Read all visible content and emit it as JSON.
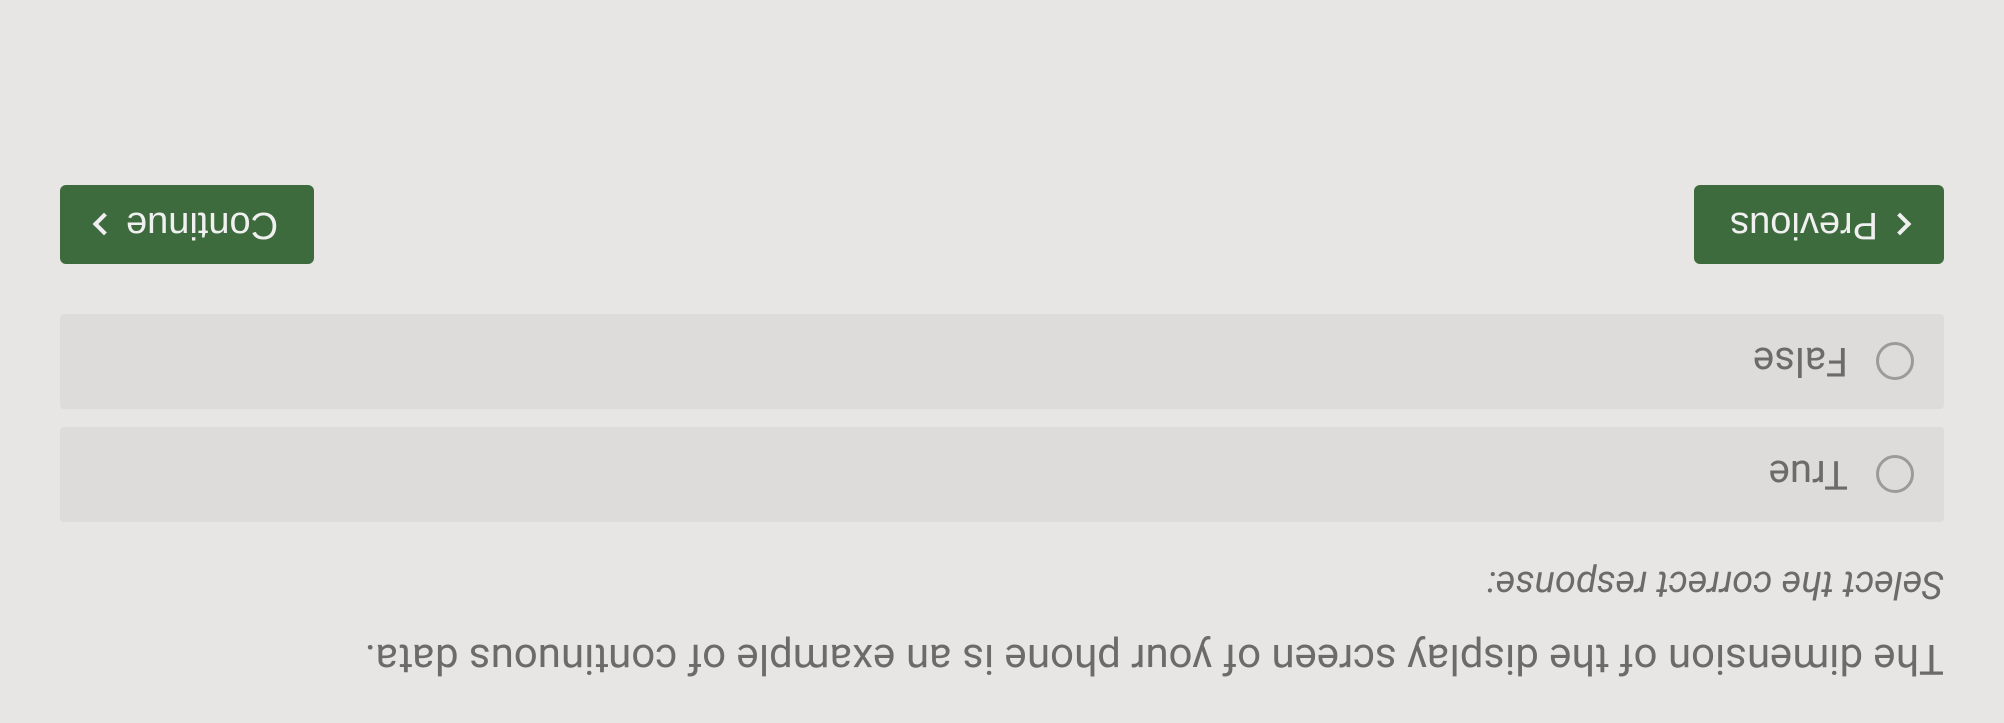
{
  "question": {
    "text": "The dimension of the display screen of your phone is an example of continuous data.",
    "instruction": "Select the correct response:",
    "options": [
      {
        "label": "True"
      },
      {
        "label": "False"
      }
    ]
  },
  "nav": {
    "previous_label": "Previous",
    "continue_label": "Continue"
  }
}
